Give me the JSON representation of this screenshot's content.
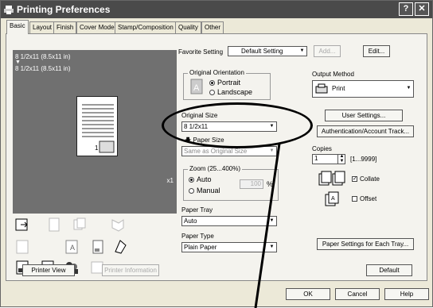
{
  "window": {
    "title": "Printing Preferences"
  },
  "tabs": [
    {
      "label": "Basic",
      "active": true
    },
    {
      "label": "Layout"
    },
    {
      "label": "Finish"
    },
    {
      "label": "Cover Mode"
    },
    {
      "label": "Stamp/Composition"
    },
    {
      "label": "Quality"
    },
    {
      "label": "Other"
    }
  ],
  "preview": {
    "paper_line1": "8 1/2x11 (8.5x11 in)",
    "paper_line2": "8 1/2x11 (8.5x11 in)",
    "zoom": "x1",
    "printer_view_label": "Printer View",
    "printer_info_label": "Printer Information"
  },
  "favorite": {
    "label": "Favorite Setting",
    "value": "Default Setting",
    "add_label": "Add...",
    "edit_label": "Edit..."
  },
  "orientation": {
    "label": "Original Orientation",
    "portrait": "Portrait",
    "landscape": "Landscape",
    "selected": "Portrait"
  },
  "original_size": {
    "label": "Original Size",
    "value": "8 1/2x11"
  },
  "paper_size": {
    "label": "Paper Size",
    "value": "Same as Original Size"
  },
  "zoom": {
    "label": "Zoom (25...400%)",
    "auto": "Auto",
    "manual": "Manual",
    "value": "100",
    "unit": "%"
  },
  "paper_tray": {
    "label": "Paper Tray",
    "value": "Auto"
  },
  "paper_type": {
    "label": "Paper Type",
    "value": "Plain Paper"
  },
  "output_method": {
    "label": "Output Method",
    "value": "Print"
  },
  "user_settings_label": "User Settings...",
  "auth_label": "Authentication/Account Track...",
  "copies": {
    "label": "Copies",
    "value": "1",
    "range": "[1...9999]"
  },
  "collate_label": "Collate",
  "offset_label": "Offset",
  "paper_settings_label": "Paper Settings for Each Tray...",
  "default_label": "Default",
  "footer": {
    "ok": "OK",
    "cancel": "Cancel",
    "help": "Help"
  }
}
